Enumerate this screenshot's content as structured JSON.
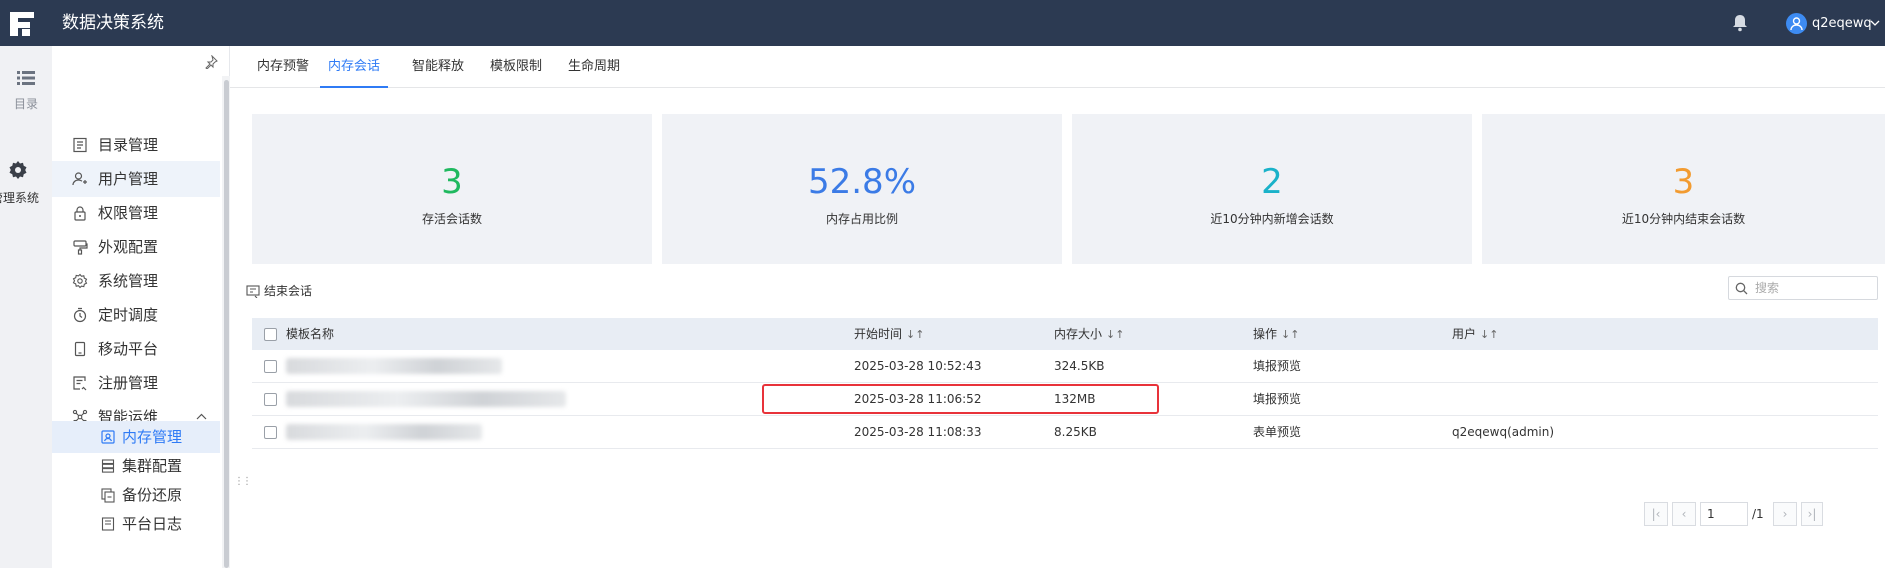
{
  "app": {
    "title": "数据决策系统",
    "username": "q2eqewq"
  },
  "rail": [
    {
      "label": "目录",
      "icon": "list-icon"
    },
    {
      "label": "管理系统",
      "icon": "gear-icon"
    }
  ],
  "sidebar": {
    "items": [
      {
        "label": "目录管理",
        "icon": "catalog-icon"
      },
      {
        "label": "用户管理",
        "icon": "user-icon"
      },
      {
        "label": "权限管理",
        "icon": "lock-icon"
      },
      {
        "label": "外观配置",
        "icon": "paint-icon"
      },
      {
        "label": "系统管理",
        "icon": "settings-icon"
      },
      {
        "label": "定时调度",
        "icon": "timer-icon"
      },
      {
        "label": "移动平台",
        "icon": "mobile-icon"
      },
      {
        "label": "注册管理",
        "icon": "register-icon"
      },
      {
        "label": "智能运维",
        "icon": "ops-icon"
      }
    ],
    "subitems": [
      {
        "label": "内存管理",
        "icon": "memory-icon",
        "active": true
      },
      {
        "label": "集群配置",
        "icon": "cluster-icon"
      },
      {
        "label": "备份还原",
        "icon": "backup-icon"
      },
      {
        "label": "平台日志",
        "icon": "log-icon"
      }
    ]
  },
  "tabs": [
    "内存预警",
    "内存会话",
    "智能释放",
    "模板限制",
    "生命周期"
  ],
  "active_tab": "内存会话",
  "stats": [
    {
      "value": "3",
      "label": "存活会话数",
      "color": "#1fb95f"
    },
    {
      "value": "52.8%",
      "label": "内存占用比例",
      "color": "#3b7be6"
    },
    {
      "value": "2",
      "label": "近10分钟内新增会话数",
      "color": "#1ab2c9"
    },
    {
      "value": "3",
      "label": "近10分钟内结束会话数",
      "color": "#f29b30"
    }
  ],
  "toolbar": {
    "end_session": "结束会话",
    "search_placeholder": "搜索"
  },
  "table": {
    "headers": [
      "模板名称",
      "开始时间",
      "内存大小",
      "操作",
      "用户"
    ],
    "rows": [
      {
        "name": "",
        "start": "2025-03-28 10:52:43",
        "size": "324.5KB",
        "op": "填报预览",
        "user": ""
      },
      {
        "name": "",
        "start": "2025-03-28 11:06:52",
        "size": "132MB",
        "op": "填报预览",
        "user": ""
      },
      {
        "name": "",
        "start": "2025-03-28 11:08:33",
        "size": "8.25KB",
        "op": "表单预览",
        "user": "q2eqewq(admin)"
      }
    ]
  },
  "pagination": {
    "current": "1",
    "total": "/1"
  }
}
